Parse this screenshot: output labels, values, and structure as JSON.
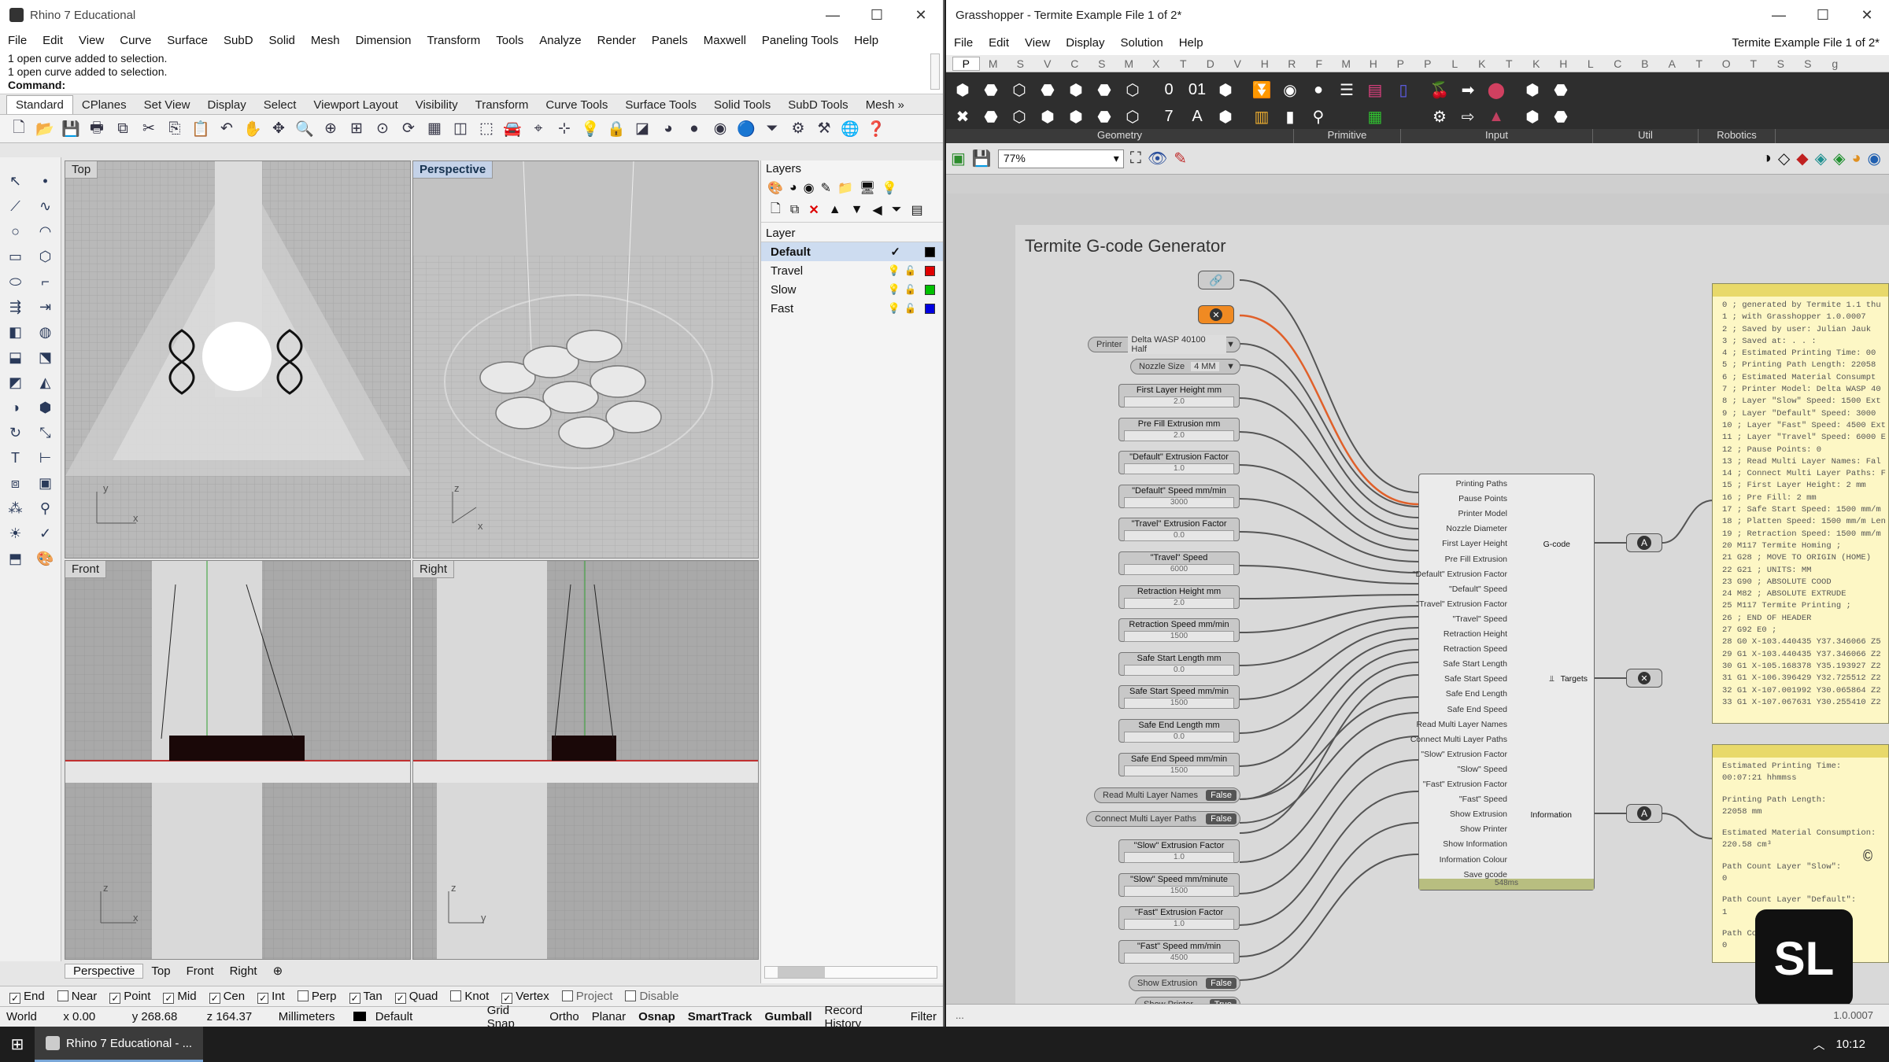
{
  "rhino": {
    "title": "Rhino 7 Educational",
    "menu": [
      "File",
      "Edit",
      "View",
      "Curve",
      "Surface",
      "SubD",
      "Solid",
      "Mesh",
      "Dimension",
      "Transform",
      "Tools",
      "Analyze",
      "Render",
      "Panels",
      "Maxwell",
      "Paneling Tools",
      "Help"
    ],
    "history": [
      "1 open curve added to selection.",
      "1 open curve added to selection."
    ],
    "command_label": "Command:",
    "tabs": [
      "Standard",
      "CPlanes",
      "Set View",
      "Display",
      "Select",
      "Viewport Layout",
      "Visibility",
      "Transform",
      "Curve Tools",
      "Surface Tools",
      "Solid Tools",
      "SubD Tools",
      "Mesh »"
    ],
    "viewports": {
      "top": "Top",
      "perspective": "Perspective",
      "front": "Front",
      "right": "Right"
    },
    "layers": {
      "title": "Layers",
      "header": "Layer",
      "items": [
        {
          "name": "Default",
          "color": "#000000"
        },
        {
          "name": "Travel",
          "color": "#e00000"
        },
        {
          "name": "Slow",
          "color": "#00c000"
        },
        {
          "name": "Fast",
          "color": "#0000e0"
        }
      ]
    },
    "vp_tabs": [
      "Perspective",
      "Top",
      "Front",
      "Right"
    ],
    "osnaps": [
      {
        "label": "End",
        "checked": true
      },
      {
        "label": "Near",
        "checked": false
      },
      {
        "label": "Point",
        "checked": true
      },
      {
        "label": "Mid",
        "checked": true
      },
      {
        "label": "Cen",
        "checked": true
      },
      {
        "label": "Int",
        "checked": true
      },
      {
        "label": "Perp",
        "checked": false
      },
      {
        "label": "Tan",
        "checked": true
      },
      {
        "label": "Quad",
        "checked": true
      },
      {
        "label": "Knot",
        "checked": false
      },
      {
        "label": "Vertex",
        "checked": true
      },
      {
        "label": "Project",
        "checked": false
      },
      {
        "label": "Disable",
        "checked": false
      }
    ],
    "status": {
      "cplane": "World",
      "x": "x 0.00",
      "y": "y 268.68",
      "z": "z 164.37",
      "units": "Millimeters",
      "layer": "Default",
      "items": [
        "Grid Snap",
        "Ortho",
        "Planar",
        "Osnap",
        "SmartTrack",
        "Gumball",
        "Record History",
        "Filter"
      ]
    }
  },
  "gh": {
    "title": "Grasshopper - Termite Example File 1 of 2*",
    "doc_title": "Termite Example File 1 of 2*",
    "menu": [
      "File",
      "Edit",
      "View",
      "Display",
      "Solution",
      "Help"
    ],
    "tabs": [
      "P",
      "M",
      "S",
      "V",
      "C",
      "S",
      "M",
      "X",
      "T",
      "D",
      "V",
      "H",
      "R",
      "F",
      "M",
      "H",
      "P",
      "P",
      "L",
      "K",
      "T",
      "K",
      "H",
      "L",
      "C",
      "B",
      "A",
      "T",
      "O",
      "T",
      "S",
      "S",
      "g"
    ],
    "ribbon_groups": [
      "Geometry",
      "Primitive",
      "Input",
      "Util",
      "Robotics"
    ],
    "zoom": "77%",
    "group_title": "Termite G-code Generator",
    "printer": {
      "label": "Printer",
      "value": "Delta WASP 40100 Half"
    },
    "nozzle": {
      "label": "Nozzle Size",
      "value": "4 MM"
    },
    "sliders": [
      {
        "label": "First Layer Height mm",
        "value": "2.0"
      },
      {
        "label": "Pre Fill Extrusion mm",
        "value": "2.0"
      },
      {
        "label": "\"Default\" Extrusion Factor",
        "value": "1.0"
      },
      {
        "label": "\"Default\" Speed mm/min",
        "value": "3000"
      },
      {
        "label": "\"Travel\" Extrusion Factor",
        "value": "0.0"
      },
      {
        "label": "\"Travel\" Speed",
        "value": "6000"
      },
      {
        "label": "Retraction Height mm",
        "value": "2.0"
      },
      {
        "label": "Retraction Speed mm/min",
        "value": "1500"
      },
      {
        "label": "Safe Start Length mm",
        "value": "0.0"
      },
      {
        "label": "Safe Start Speed mm/min",
        "value": "1500"
      },
      {
        "label": "Safe End Length mm",
        "value": "0.0"
      },
      {
        "label": "Safe End Speed mm/min",
        "value": "1500"
      }
    ],
    "toggles1": [
      {
        "label": "Read Multi Layer Names",
        "value": "False"
      },
      {
        "label": "Connect Multi Layer Paths",
        "value": "False"
      }
    ],
    "sliders2": [
      {
        "label": "\"Slow\" Extrusion Factor",
        "value": "1.0"
      },
      {
        "label": "\"Slow\" Speed mm/minute",
        "value": "1500"
      },
      {
        "label": "\"Fast\" Extrusion Factor",
        "value": "1.0"
      },
      {
        "label": "\"Fast\" Speed mm/min",
        "value": "4500"
      }
    ],
    "toggles2": [
      {
        "label": "Show Extrusion",
        "value": "False"
      },
      {
        "label": "Show Printer",
        "value": "True"
      }
    ],
    "component_inputs": [
      "Printing Paths",
      "Pause Points",
      "Printer Model",
      "Nozzle Diameter",
      "First Layer Height",
      "Pre Fill Extrusion",
      "\"Default\" Extrusion Factor",
      "\"Default\" Speed",
      "\"Travel\" Extrusion Factor",
      "\"Travel\" Speed",
      "Retraction Height",
      "Retraction Speed",
      "Safe Start Length",
      "Safe Start Speed",
      "Safe End Length",
      "Safe End Speed",
      "Read Multi Layer Names",
      "Connect Multi Layer Paths",
      "\"Slow\" Extrusion Factor",
      "\"Slow\" Speed",
      "\"Fast\" Extrusion Factor",
      "\"Fast\" Speed",
      "Show Extrusion",
      "Show Printer",
      "Show Information",
      "Information Colour",
      "Save gcode"
    ],
    "component_outputs": {
      "gcode": "G-code",
      "targets": "Targets",
      "information": "Information"
    },
    "component_time": "548ms",
    "gcode_panel": [
      "0 ; generated by Termite 1.1 thu",
      "1 ; with Grasshopper 1.0.0007",
      "2 ; Saved by user: Julian Jauk",
      "3 ; Saved at: . . :",
      "4 ; Estimated Printing Time: 00",
      "5 ; Printing Path Length: 22058",
      "6 ; Estimated Material Consumpt",
      "7 ; Printer Model: Delta WASP 40",
      "8 ; Layer \"Slow\" Speed: 1500 Ext",
      "9 ; Layer \"Default\" Speed: 3000",
      "10 ; Layer \"Fast\" Speed: 4500 Ext",
      "11 ; Layer \"Travel\" Speed: 6000 E",
      "12 ; Pause Points: 0",
      "13 ; Read Multi Layer Names: Fal",
      "14 ; Connect Multi Layer Paths: F",
      "15 ; First Layer Height: 2 mm",
      "16 ; Pre Fill: 2 mm",
      "17 ; Safe Start Speed: 1500 mm/m",
      "18 ; Platten Speed: 1500 mm/m Len",
      "19 ; Retraction Speed: 1500 mm/m",
      "20 M117 Termite Homing ;",
      "21 G28 ; MOVE TO ORIGIN (HOME)",
      "22 G21 ; UNITS: MM",
      "23 G90 ; ABSOLUTE COOD",
      "24 M82 ; ABSOLUTE EXTRUDE",
      "25 M117 Termite Printing ;",
      "26 ; END OF HEADER",
      "27 G92 E0 ;",
      "28 G0 X-103.440435 Y37.346066 Z5",
      "29 G1 X-103.440435 Y37.346066 Z2",
      "30 G1 X-105.168378 Y35.193927 Z2",
      "31 G1 X-106.396429 Y32.725512 Z2",
      "32 G1 X-107.001992 Y30.065864 Z2",
      "33 G1 X-107.067631 Y30.255410 Z2"
    ],
    "info_panel": [
      "Estimated Printing Time:",
      "00:07:21 hhmmss",
      "",
      "Printing Path Length:",
      "22058 mm",
      "",
      "Estimated Material Consumption:",
      "220.58 cm³",
      "",
      "Path Count Layer \"Slow\":",
      "0",
      "",
      "Path Count Layer \"Default\":",
      "1",
      "",
      "Path Cou",
      "0",
      "",
      "Path Co",
      "0"
    ],
    "version": "1.0.0007"
  },
  "taskbar": {
    "app": "Rhino 7 Educational - ...",
    "time": "10:12"
  },
  "watermark": "SL"
}
